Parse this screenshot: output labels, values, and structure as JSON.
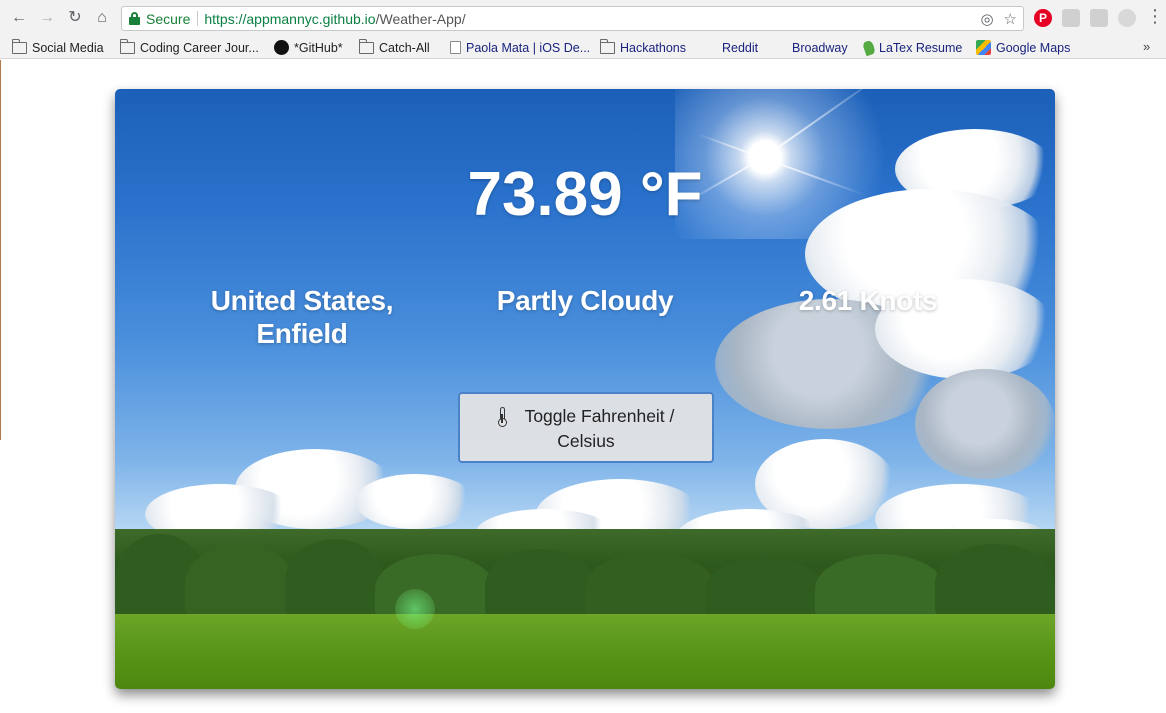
{
  "browser": {
    "secure_label": "Secure",
    "url_scheme_host": "https://appmannyc.github.io",
    "url_path": "/Weather-App/",
    "bookmarks": [
      {
        "label": "Social Media",
        "icon": "folder-icon"
      },
      {
        "label": "Coding Career Jour...",
        "icon": "folder-icon"
      },
      {
        "label": "*GitHub*",
        "icon": "github-icon"
      },
      {
        "label": "Catch-All",
        "icon": "folder-icon"
      },
      {
        "label": "Paola Mata | iOS De...",
        "icon": "page-icon"
      },
      {
        "label": "Hackathons",
        "icon": "folder-icon"
      },
      {
        "label": "Reddit",
        "icon": "reddit-icon"
      },
      {
        "label": "Broadway",
        "icon": "broadway-icon"
      },
      {
        "label": "LaTex Resume",
        "icon": "overleaf-icon"
      },
      {
        "label": "Google Maps",
        "icon": "google-maps-icon"
      }
    ],
    "more_bookmarks": "»"
  },
  "weather": {
    "temperature": "73.89 °F",
    "location_line1": "United States,",
    "location_line2": "Enfield",
    "condition": "Partly Cloudy",
    "wind": "2.61 Knots",
    "toggle_label_line1": "Toggle Fahrenheit /",
    "toggle_label_line2": "Celsius"
  },
  "colors": {
    "accent_blue": "#4a82c8",
    "secure_green": "#188038",
    "text_white": "#ffffff"
  }
}
